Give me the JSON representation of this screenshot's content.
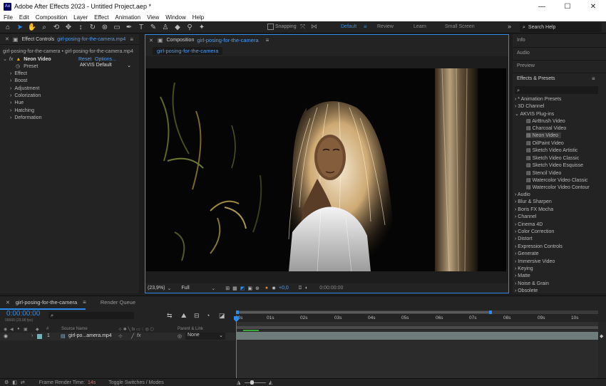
{
  "window": {
    "title": "Adobe After Effects 2023 - Untitled Project.aep *",
    "app_icon_text": "Ae",
    "minimize": "—",
    "maximize": "☐",
    "close": "✕"
  },
  "menu": [
    "File",
    "Edit",
    "Composition",
    "Layer",
    "Effect",
    "Animation",
    "View",
    "Window",
    "Help"
  ],
  "toolbar": {
    "snapping_label": "Snapping",
    "workspaces": [
      "Default",
      "Review",
      "Learn",
      "Small Screen"
    ],
    "more": "»",
    "search_placeholder": "Search Help"
  },
  "effect_controls": {
    "tab_label": "Effect Controls",
    "tab_file": "girl-posing-for-the-camera.mp4",
    "breadcrumb": "girl-posing-for-the-camera • girl-posing-for-the-camera.mp4",
    "fx_label": "fx",
    "effect_name": "Neon Video",
    "reset": "Reset",
    "options": "Options...",
    "preset_label": "Preset",
    "preset_value": "AKVIS Default",
    "groups": [
      "Effect",
      "Boost",
      "Adjustment",
      "Colorization",
      "Hue",
      "Hatching",
      "Deformation"
    ]
  },
  "composition": {
    "tab_prefix": "Composition",
    "tab_name": "girl-posing-for-the-camera",
    "sub_tab": "girl-posing-for-the-camera",
    "zoom": "(23,9%)",
    "resolution": "Full",
    "exposure": "+0,0",
    "timecode": "0:00:00:00"
  },
  "right_panel": {
    "info": "Info",
    "audio": "Audio",
    "preview": "Preview",
    "effects_presets": "Effects & Presets",
    "search_placeholder": "",
    "categories_top": [
      "* Animation Presets",
      "3D Channel",
      "AKVIS Plug-ins"
    ],
    "akvis_items": [
      "AirBrush Video",
      "Charcoal Video",
      "Neon Video",
      "OilPaint Video",
      "Sketch Video Artistic",
      "Sketch Video Classic",
      "Sketch Video Esquisse",
      "Stencil Video",
      "Watercolor Video Classic",
      "Watercolor Video Contour"
    ],
    "categories_bottom": [
      "Audio",
      "Blur & Sharpen",
      "Boris FX Mocha",
      "Channel",
      "Cinema 4D",
      "Color Correction",
      "Distort",
      "Expression Controls",
      "Generate",
      "Immersive Video",
      "Keying",
      "Matte",
      "Noise & Grain",
      "Obsolete"
    ]
  },
  "timeline": {
    "tab_name": "girl-posing-for-the-camera",
    "render_queue": "Render Queue",
    "timecode": "0:00:00:00",
    "timecode_sub": "00000 (23.98 fps)",
    "col_num": "#",
    "col_source": "Source Name",
    "col_parent": "Parent & Link",
    "layer_num": "1",
    "layer_name": "girl-po...amera.mp4",
    "layer_parent": "None",
    "ruler": [
      "00s",
      "01s",
      "02s",
      "03s",
      "04s",
      "05s",
      "06s",
      "07s",
      "08s",
      "09s",
      "10s"
    ]
  },
  "status": {
    "frame_render_label": "Frame Render Time:",
    "frame_render_value": "14s",
    "toggle": "Toggle Switches / Modes"
  },
  "colors": {
    "accent": "#2d8ceb",
    "panel": "#232323",
    "background": "#1d1d1d"
  }
}
